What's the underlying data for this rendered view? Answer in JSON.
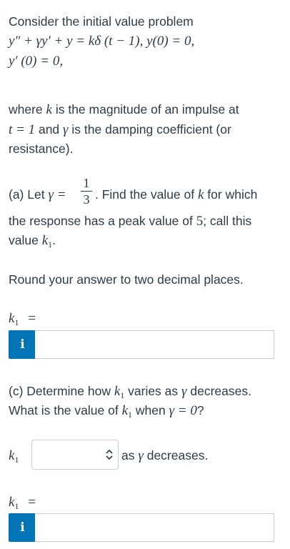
{
  "intro": {
    "lead": "Consider the initial value problem",
    "equation_line1": "y″ + γy′ + y = kδ (t − 1),  y(0) = 0,",
    "equation_line2": "y′ (0) = 0,"
  },
  "description": {
    "line1_a": "where ",
    "line1_k": "k",
    "line1_b": " is the magnitude of an impulse at",
    "line2_t": "t = 1",
    "line2_a": " and ",
    "line2_gamma": "γ",
    "line2_b": " is the damping coefficient (or",
    "line3": "resistance)."
  },
  "part_a": {
    "label": "(a) Let ",
    "gamma_eq": "γ =",
    "frac_num": "1",
    "frac_den": "3",
    "after_frac": ". Find the value of ",
    "k": "k",
    "for_which": " for which",
    "line2_a": "the response has a peak value of ",
    "peak": "5",
    "line2_b": ";  call this",
    "line3_a": "value ",
    "line3_k": "k",
    "line3_sub": "1",
    "line3_b": ".",
    "round_note": "Round your answer to two decimal places.",
    "answer_label_k": "k",
    "answer_label_sub": "1",
    "answer_label_eq": "=",
    "info_icon_glyph": "i",
    "answer_value": ""
  },
  "part_c": {
    "line1_a": "(c) Determine how ",
    "line1_k": "k",
    "line1_sub": "1",
    "line1_b": " varies as ",
    "line1_gamma": "γ",
    "line1_c": " decreases.",
    "line2_a": "What is the value of ",
    "line2_k": "k",
    "line2_sub": "1",
    "line2_b": " when ",
    "line2_cond": "γ = 0",
    "line2_c": "?",
    "select_label_k": "k",
    "select_label_sub": "1",
    "select_value": "",
    "select_suffix_a": "as ",
    "select_suffix_gamma": "γ",
    "select_suffix_b": " decreases.",
    "answer_label_k": "k",
    "answer_label_sub": "1",
    "answer_label_eq": "=",
    "info_icon_glyph": "i",
    "answer_value": ""
  },
  "colors": {
    "text": "#2d3b45",
    "info_badge": "#0374b5",
    "input_border": "#c7cdd1"
  }
}
